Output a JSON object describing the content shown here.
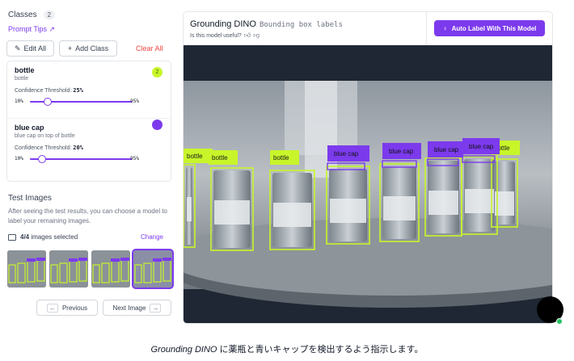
{
  "classes_panel": {
    "title": "Classes",
    "count": "2",
    "prompt_tips": "Prompt Tips ↗",
    "edit_all": "Edit All",
    "add_class": "Add Class",
    "clear_all": "Clear All",
    "items": [
      {
        "name": "bottle",
        "description": "bottle",
        "threshold_label": "Confidence Threshold:",
        "threshold": "25%",
        "threshold_value": 25,
        "min": "10%",
        "max": "95%",
        "badge": "2",
        "color": "#c8f52a"
      },
      {
        "name": "blue cap",
        "description": "blue cap on top of bottle",
        "threshold_label": "Confidence Threshold:",
        "threshold": "20%",
        "threshold_value": 20,
        "min": "10%",
        "max": "95%",
        "color": "#7c3aed"
      }
    ]
  },
  "test_images": {
    "title": "Test Images",
    "description": "After seeing the test results, you can choose a model to label your remaining images.",
    "selected_count": "4/4",
    "selected_suffix": "images selected",
    "change": "Change",
    "prev": "Previous",
    "next": "Next Image",
    "selected_index": 3
  },
  "model_panel": {
    "title": "Grounding DINO",
    "subtitle": "Bounding box labels",
    "useful_question": "Is this model useful?",
    "auto_label": "Auto Label With This Model"
  },
  "detections": {
    "bottle_label": "bottle",
    "cap_label": "blue cap"
  },
  "caption": {
    "italic": "Grounding DINO",
    "rest": " に薬瓶と青いキャップを検出するよう指示します。"
  },
  "colors": {
    "accent": "#7c3aed",
    "bottle_box": "#c8f52a",
    "danger": "#ef4444"
  }
}
